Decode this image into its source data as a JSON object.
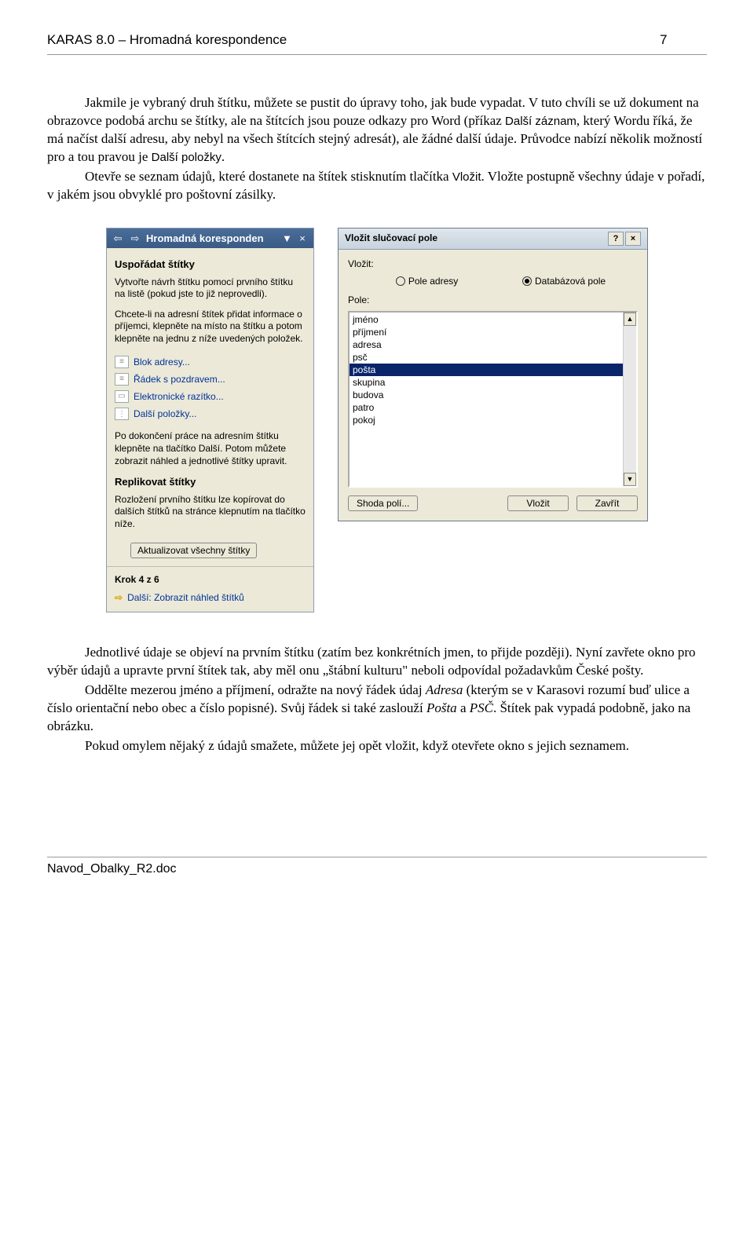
{
  "header": {
    "title": "KARAS 8.0 – Hromadná korespondence",
    "page": "7"
  },
  "text": {
    "p1": "Jakmile je vybraný druh štítku, můžete se pustit do úpravy toho, jak bude vypadat. V tuto chvíli se už dokument na obrazovce podobá archu se štítky, ale na štítcích jsou pouze odkazy pro Word (příkaz ",
    "p1_cmd": "Další záznam",
    "p1_b": ", který Wordu říká, že má načíst další adresu, aby nebyl na všech štítcích stejný adresát), ale žádné další údaje. Průvodce nabízí několik možností pro a tou pravou je ",
    "p1_cmd2": "Další položky",
    "p1_c": ".",
    "p2": "Otevře se seznam údajů, které dostanete na štítek stisknutím tlačítka ",
    "p2_cmd": "Vložit",
    "p2_b": ". Vložte postupně všechny údaje v pořadí, v jakém jsou obvyklé pro poštovní zásilky.",
    "p3": "Jednotlivé údaje se objeví na prvním štítku (zatím bez konkrétních jmen, to přijde později). Nyní zavřete okno pro výběr údajů a upravte první štítek tak, aby měl onu „štábní kulturu\" neboli odpovídal požadavkům České pošty.",
    "p4a": "Oddělte mezerou jméno a příjmení, odražte na nový řádek údaj ",
    "p4_i1": "Adresa",
    "p4b": " (kterým se v Karasovi rozumí buď ulice a číslo orientační nebo obec a číslo popisné). Svůj řádek si také zaslouží ",
    "p4_i2": "Pošta",
    "p4c": " a ",
    "p4_i3": "PSČ",
    "p4d": ". Štítek pak vypadá podobně, jako na obrázku.",
    "p5": "Pokud omylem nějaký z údajů smažete, můžete jej opět vložit, když otevřete okno s jejich seznamem."
  },
  "taskpane": {
    "title": "Hromadná koresponden",
    "section1_h": "Uspořádat štítky",
    "section1_t1": "Vytvořte návrh štítku pomocí prvního štítku na listě (pokud jste to již neprovedli).",
    "section1_t2": "Chcete-li na adresní štítek přidat informace o příjemci, klepněte na místo na štítku a potom klepněte na jednu z níže uvedených položek.",
    "link1": "Blok adresy...",
    "link2": "Řádek s pozdravem...",
    "link3": "Elektronické razítko...",
    "link4": "Další položky...",
    "section1_t3": "Po dokončení práce na adresním štítku klepněte na tlačítko Další. Potom můžete zobrazit náhled a jednotlivé štítky upravit.",
    "section2_h": "Replikovat štítky",
    "section2_t": "Rozložení prvního štítku lze kopírovat do dalších štítků na stránce klepnutím na tlačítko níže.",
    "btn_update": "Aktualizovat všechny štítky",
    "step": "Krok 4 z 6",
    "next": "Další: Zobrazit náhled štítků"
  },
  "dialog": {
    "title": "Vložit slučovací pole",
    "insert_label": "Vložit:",
    "radio1": "Pole adresy",
    "radio2": "Databázová pole",
    "field_label": "Pole:",
    "items": [
      "jméno",
      "příjmení",
      "adresa",
      "psč",
      "pošta",
      "skupina",
      "budova",
      "patro",
      "pokoj"
    ],
    "selected_item": "pošta",
    "btn_match": "Shoda polí...",
    "btn_insert": "Vložit",
    "btn_close": "Zavřít"
  },
  "footer": {
    "filename": "Navod_Obalky_R2.doc"
  }
}
